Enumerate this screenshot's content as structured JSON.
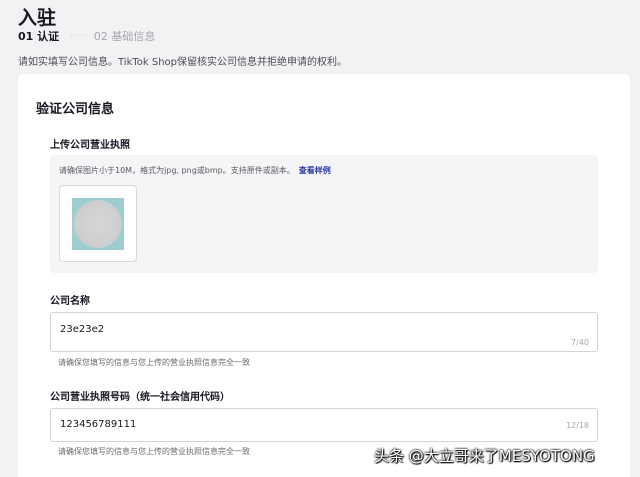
{
  "page": {
    "title": "入驻",
    "steps": [
      {
        "label": "01 认证"
      },
      {
        "label": "02 基础信息"
      }
    ],
    "steps_separator": "····",
    "notice": "请如实填写公司信息。TikTok Shop保留核实公司信息并拒绝申请的权利。"
  },
  "card": {
    "title": "验证公司信息",
    "license_upload": {
      "label": "上传公司营业执照",
      "hint": "请确保图片小于10M，格式为jpg, png或bmp。支持原件或副本。",
      "sample_link": "查看样例"
    },
    "company_name": {
      "label": "公司名称",
      "value": "23e23e2",
      "count": "7/40",
      "help": "请确保您填写的信息与您上传的营业执照信息完全一致"
    },
    "license_number": {
      "label": "公司营业执照号码（统一社会信用代码）",
      "value": "123456789111",
      "count": "12/18",
      "help": "请确保您填写的信息与您上传的营业执照信息完全一致"
    }
  },
  "watermark": "头条 @大立哥来了MESYOTONG"
}
